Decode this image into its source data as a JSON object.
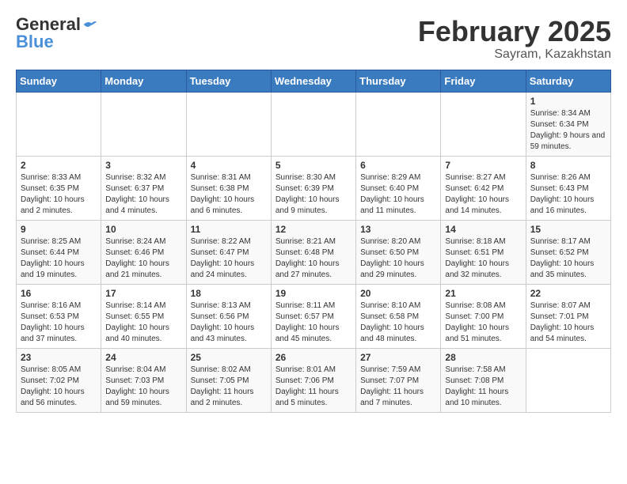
{
  "header": {
    "logo_general": "General",
    "logo_blue": "Blue",
    "month_title": "February 2025",
    "subtitle": "Sayram, Kazakhstan"
  },
  "calendar": {
    "weekdays": [
      "Sunday",
      "Monday",
      "Tuesday",
      "Wednesday",
      "Thursday",
      "Friday",
      "Saturday"
    ],
    "weeks": [
      [
        {
          "day": "",
          "info": ""
        },
        {
          "day": "",
          "info": ""
        },
        {
          "day": "",
          "info": ""
        },
        {
          "day": "",
          "info": ""
        },
        {
          "day": "",
          "info": ""
        },
        {
          "day": "",
          "info": ""
        },
        {
          "day": "1",
          "info": "Sunrise: 8:34 AM\nSunset: 6:34 PM\nDaylight: 9 hours and 59 minutes."
        }
      ],
      [
        {
          "day": "2",
          "info": "Sunrise: 8:33 AM\nSunset: 6:35 PM\nDaylight: 10 hours and 2 minutes."
        },
        {
          "day": "3",
          "info": "Sunrise: 8:32 AM\nSunset: 6:37 PM\nDaylight: 10 hours and 4 minutes."
        },
        {
          "day": "4",
          "info": "Sunrise: 8:31 AM\nSunset: 6:38 PM\nDaylight: 10 hours and 6 minutes."
        },
        {
          "day": "5",
          "info": "Sunrise: 8:30 AM\nSunset: 6:39 PM\nDaylight: 10 hours and 9 minutes."
        },
        {
          "day": "6",
          "info": "Sunrise: 8:29 AM\nSunset: 6:40 PM\nDaylight: 10 hours and 11 minutes."
        },
        {
          "day": "7",
          "info": "Sunrise: 8:27 AM\nSunset: 6:42 PM\nDaylight: 10 hours and 14 minutes."
        },
        {
          "day": "8",
          "info": "Sunrise: 8:26 AM\nSunset: 6:43 PM\nDaylight: 10 hours and 16 minutes."
        }
      ],
      [
        {
          "day": "9",
          "info": "Sunrise: 8:25 AM\nSunset: 6:44 PM\nDaylight: 10 hours and 19 minutes."
        },
        {
          "day": "10",
          "info": "Sunrise: 8:24 AM\nSunset: 6:46 PM\nDaylight: 10 hours and 21 minutes."
        },
        {
          "day": "11",
          "info": "Sunrise: 8:22 AM\nSunset: 6:47 PM\nDaylight: 10 hours and 24 minutes."
        },
        {
          "day": "12",
          "info": "Sunrise: 8:21 AM\nSunset: 6:48 PM\nDaylight: 10 hours and 27 minutes."
        },
        {
          "day": "13",
          "info": "Sunrise: 8:20 AM\nSunset: 6:50 PM\nDaylight: 10 hours and 29 minutes."
        },
        {
          "day": "14",
          "info": "Sunrise: 8:18 AM\nSunset: 6:51 PM\nDaylight: 10 hours and 32 minutes."
        },
        {
          "day": "15",
          "info": "Sunrise: 8:17 AM\nSunset: 6:52 PM\nDaylight: 10 hours and 35 minutes."
        }
      ],
      [
        {
          "day": "16",
          "info": "Sunrise: 8:16 AM\nSunset: 6:53 PM\nDaylight: 10 hours and 37 minutes."
        },
        {
          "day": "17",
          "info": "Sunrise: 8:14 AM\nSunset: 6:55 PM\nDaylight: 10 hours and 40 minutes."
        },
        {
          "day": "18",
          "info": "Sunrise: 8:13 AM\nSunset: 6:56 PM\nDaylight: 10 hours and 43 minutes."
        },
        {
          "day": "19",
          "info": "Sunrise: 8:11 AM\nSunset: 6:57 PM\nDaylight: 10 hours and 45 minutes."
        },
        {
          "day": "20",
          "info": "Sunrise: 8:10 AM\nSunset: 6:58 PM\nDaylight: 10 hours and 48 minutes."
        },
        {
          "day": "21",
          "info": "Sunrise: 8:08 AM\nSunset: 7:00 PM\nDaylight: 10 hours and 51 minutes."
        },
        {
          "day": "22",
          "info": "Sunrise: 8:07 AM\nSunset: 7:01 PM\nDaylight: 10 hours and 54 minutes."
        }
      ],
      [
        {
          "day": "23",
          "info": "Sunrise: 8:05 AM\nSunset: 7:02 PM\nDaylight: 10 hours and 56 minutes."
        },
        {
          "day": "24",
          "info": "Sunrise: 8:04 AM\nSunset: 7:03 PM\nDaylight: 10 hours and 59 minutes."
        },
        {
          "day": "25",
          "info": "Sunrise: 8:02 AM\nSunset: 7:05 PM\nDaylight: 11 hours and 2 minutes."
        },
        {
          "day": "26",
          "info": "Sunrise: 8:01 AM\nSunset: 7:06 PM\nDaylight: 11 hours and 5 minutes."
        },
        {
          "day": "27",
          "info": "Sunrise: 7:59 AM\nSunset: 7:07 PM\nDaylight: 11 hours and 7 minutes."
        },
        {
          "day": "28",
          "info": "Sunrise: 7:58 AM\nSunset: 7:08 PM\nDaylight: 11 hours and 10 minutes."
        },
        {
          "day": "",
          "info": ""
        }
      ]
    ]
  }
}
